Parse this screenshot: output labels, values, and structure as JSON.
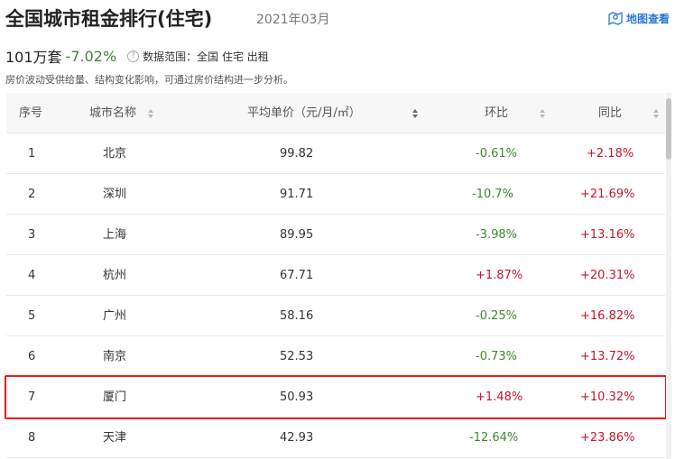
{
  "header": {
    "title": "全国城市租金排行(住宅)",
    "month": "2021年03月",
    "map_link": "地图查看"
  },
  "summary": {
    "total": "101万套",
    "change": "-7.02%",
    "scope": "数据范围：全国  住宅  出租",
    "note": "房价波动受供给量、结构变化影响，可通过房价结构进一步分析。"
  },
  "table": {
    "columns": {
      "rank": "序号",
      "city": "城市名称",
      "price": "平均单价（元/月/㎡）",
      "mom": "环比",
      "yoy": "同比"
    },
    "rows": [
      {
        "rank": "1",
        "city": "北京",
        "price": "99.82",
        "mom": "-0.61%",
        "yoy": "+2.18%"
      },
      {
        "rank": "2",
        "city": "深圳",
        "price": "91.71",
        "mom": "-10.7%",
        "yoy": "+21.69%"
      },
      {
        "rank": "3",
        "city": "上海",
        "price": "89.95",
        "mom": "-3.98%",
        "yoy": "+13.16%"
      },
      {
        "rank": "4",
        "city": "杭州",
        "price": "67.71",
        "mom": "+1.87%",
        "yoy": "+20.31%"
      },
      {
        "rank": "5",
        "city": "广州",
        "price": "58.16",
        "mom": "-0.25%",
        "yoy": "+16.82%"
      },
      {
        "rank": "6",
        "city": "南京",
        "price": "52.53",
        "mom": "-0.73%",
        "yoy": "+13.72%"
      },
      {
        "rank": "7",
        "city": "厦门",
        "price": "50.93",
        "mom": "+1.48%",
        "yoy": "+10.32%"
      },
      {
        "rank": "8",
        "city": "天津",
        "price": "42.93",
        "mom": "-12.64%",
        "yoy": "+23.86%"
      }
    ]
  },
  "colors": {
    "negative": "#3c8a2e",
    "positive": "#c7162b",
    "highlight": "#e3201b",
    "link": "#2a78d8"
  }
}
